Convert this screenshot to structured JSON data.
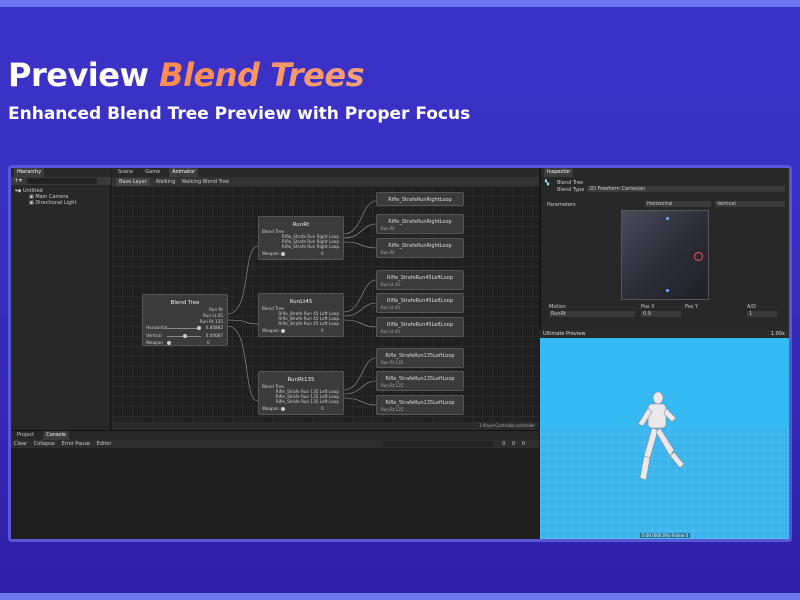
{
  "hero": {
    "title_plain": "Preview ",
    "title_accent": "Blend Trees",
    "subtitle": "Enhanced Blend Tree Preview with Proper Focus"
  },
  "hierarchy": {
    "tab": "Hierarchy",
    "scene": "Untitled",
    "items": [
      "Main Camera",
      "Directional Light"
    ]
  },
  "center": {
    "tabs": [
      "Scene",
      "Game",
      "Animator"
    ],
    "base_layer": "Base Layer",
    "breadcrumbs": [
      "Walking",
      "Walking Blend Tree"
    ],
    "status": "3 PlayerController.controller"
  },
  "nodes": {
    "root": {
      "title": "Blend Tree",
      "outputs": [
        "Run Rt",
        "Run Lt 45",
        "Run Rt 135"
      ],
      "params": [
        {
          "label": "Horizontal",
          "value": "0.80882"
        },
        {
          "label": "Vertical",
          "value": "0.00087"
        },
        {
          "label": "Weapon",
          "value": "0"
        }
      ]
    },
    "runrt": {
      "title": "RunRt",
      "sub": "Blend Tree",
      "rows": [
        "Rifle_Strafe Run Right Loop",
        "Rifle_Strafe Run Right Loop",
        "Rifle_Strafe Run Right Loop"
      ],
      "param": "Weapon",
      "value": "0"
    },
    "runlt45": {
      "title": "RunLt45",
      "sub": "Blend Tree",
      "rows": [
        "Rifle_Strafe Run 45 Left Loop",
        "Rifle_Strafe Run 45 Left Loop",
        "Rifle_Strafe Run 45 Left Loop"
      ],
      "param": "Weapon",
      "value": "0"
    },
    "runrt135": {
      "title": "RunRt135",
      "sub": "Blend Tree",
      "rows": [
        "Rifle_Strafe Run 135 Left Loop",
        "Rifle_Strafe Run 135 Left Loop",
        "Rifle_Strafe Run 135 Left Loop"
      ],
      "param": "Weapon",
      "value": "0"
    }
  },
  "clips": [
    {
      "title": "Rifle_StrafeRunRightLoop",
      "sub": ""
    },
    {
      "title": "Rifle_StrafeRunRightLoop",
      "sub": "Run Rt"
    },
    {
      "title": "Rifle_StrafeRunRightLoop",
      "sub": "Run Rt"
    },
    {
      "title": "Rifle_StrafeRun45LeftLoop",
      "sub": "Run Lt 45"
    },
    {
      "title": "Rifle_StrafeRun45LeftLoop",
      "sub": "Run Lt 45"
    },
    {
      "title": "Rifle_StrafeRun45LeftLoop",
      "sub": "Run Lt 45"
    },
    {
      "title": "Rifle_StrafeRun135LeftLoop",
      "sub": "Run Rt 135"
    },
    {
      "title": "Rifle_StrafeRun135LeftLoop",
      "sub": "Run Rt 135"
    },
    {
      "title": "Rifle_StrafeRun135LeftLoop",
      "sub": "Run Rt 135"
    }
  ],
  "inspector": {
    "tab": "Inspector",
    "object": "Blend Tree",
    "blend_type_label": "Blend Type",
    "blend_type": "2D Freeform Cartesian",
    "parameters_label": "Parameters",
    "param_x": "Horizontal",
    "param_y": "Vertical",
    "col_motion": "Motion",
    "col_posx": "Pos X",
    "col_posy": "Pos Y",
    "col_speed": "A/D",
    "motion_value": "RunRt",
    "posx_value": "0.9",
    "speed_value": "1"
  },
  "preview": {
    "label": "Ultimate Preview",
    "speed": "1.00x",
    "footer": "0:00 (000.0%) Frame 0"
  },
  "project": {
    "tabs": [
      "Project",
      "Console"
    ],
    "tools": [
      "Clear",
      "Collapse",
      "Error Pause",
      "Editor"
    ],
    "counts": [
      "0",
      "0",
      "0"
    ]
  }
}
